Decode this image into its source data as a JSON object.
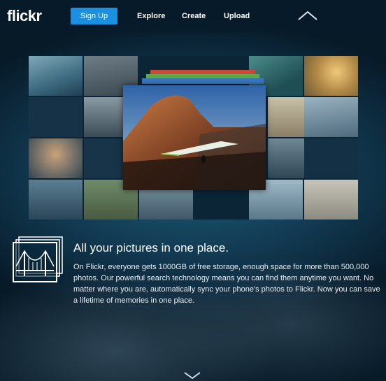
{
  "header": {
    "logo": "flickr",
    "signup_label": "Sign Up",
    "nav": [
      "Explore",
      "Create",
      "Upload"
    ],
    "collapse_icon": "chevron-up-icon"
  },
  "feature": {
    "icon": "photo-stack-bridge-icon",
    "title": "All your pictures in one place.",
    "body": "On Flickr, everyone gets 1000GB of free storage, enough space for more than 500,000 photos. Our powerful search technology means you can find them anytime you want. No matter where you are, automatically sync your phone's photos to Flickr. Now you can save a lifetime of memories in one place."
  },
  "footer": {
    "scroll_icon": "chevron-down-icon"
  },
  "colors": {
    "accent": "#1b8fe0",
    "background": "#123a52"
  }
}
